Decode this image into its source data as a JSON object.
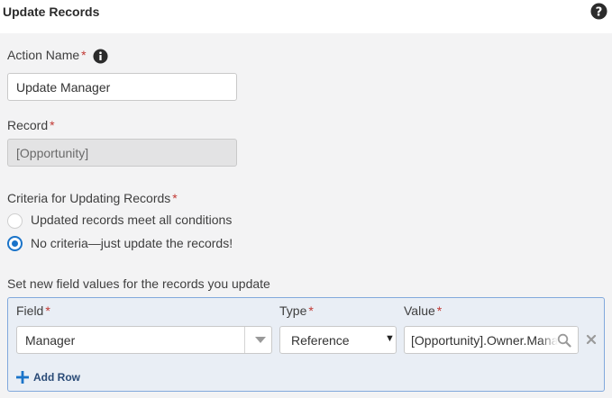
{
  "header": {
    "title": "Update Records",
    "help_icon": "question-circle-icon"
  },
  "action_name": {
    "label": "Action Name",
    "required_mark": "*",
    "info_icon": "info-circle-icon",
    "value": "Update Manager"
  },
  "record": {
    "label": "Record",
    "required_mark": "*",
    "value": "[Opportunity]"
  },
  "criteria": {
    "label": "Criteria for Updating Records",
    "required_mark": "*",
    "options": [
      {
        "label": "Updated records meet all conditions",
        "selected": false
      },
      {
        "label": "No criteria—just update the records!",
        "selected": true
      }
    ]
  },
  "field_values": {
    "label": "Set new field values for the records you update",
    "columns": {
      "field": "Field",
      "type": "Type",
      "value": "Value",
      "required_mark": "*"
    },
    "rows": [
      {
        "field": "Manager",
        "type": "Reference",
        "value": "[Opportunity].Owner.Manager"
      }
    ],
    "add_row_label": "Add Row",
    "colors": {
      "panel_border": "#82a9dc",
      "accent": "#1b74c9"
    }
  }
}
